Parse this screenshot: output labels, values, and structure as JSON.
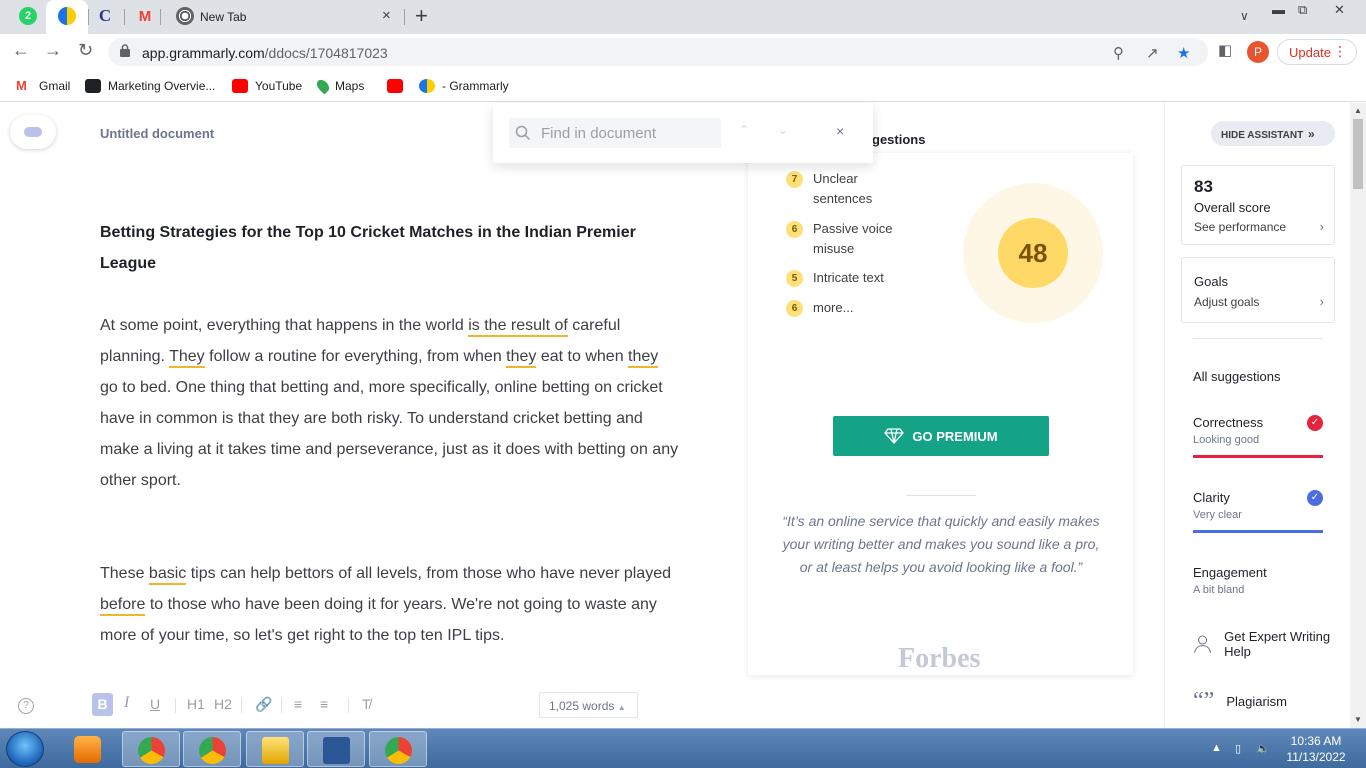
{
  "browser": {
    "tabs": [
      {
        "icon": "whatsapp-icon",
        "badge": "2"
      },
      {
        "icon": "grammarly-icon"
      },
      {
        "icon": "c-letter-icon",
        "glyph": "C"
      },
      {
        "icon": "gmail-icon",
        "glyph": "M"
      },
      {
        "icon": "chrome-icon",
        "title": "New Tab"
      }
    ],
    "close_tab": "×",
    "new_tab": "+",
    "url_host": "app.grammarly.com",
    "url_path": "/ddocs/1704817023",
    "profile_initial": "P",
    "update_label": "Update",
    "bookmarks": [
      {
        "label": "Gmail",
        "color": "#ea4335"
      },
      {
        "label": "Marketing Overvie...",
        "color": "#202124"
      },
      {
        "label": "YouTube",
        "color": "#ff0000"
      },
      {
        "label": "Maps",
        "color": "#34a853"
      },
      {
        "label": "",
        "color": "#ff0000"
      },
      {
        "label": "- Grammarly",
        "color": "#15c39a"
      }
    ]
  },
  "editor": {
    "doc_title": "Untitled document",
    "heading": "Betting Strategies for the Top 10 Cricket Matches in the Indian Premier League",
    "para1": {
      "a": "At some point, everything that happens in the world ",
      "u1": "is the result of",
      "b": " careful planning. ",
      "u2": "They",
      "c": " follow a routine for everything, from when ",
      "u3": "they",
      "d": " eat to when ",
      "u4": "they",
      "e": " go to bed. One thing that betting and, more specifically, online betting on cricket have in common is that they are both risky. To understand cricket betting and make a living at it takes time and perseverance, just as it does with betting on any other sport."
    },
    "para2": {
      "a": "These ",
      "u1": "basic",
      "b": " tips can help bettors of all levels, from those who have never played ",
      "u2": "before",
      "c": " to those who have been doing it for years. We're not going to waste any more of your time, so let's get right to the top ten IPL tips."
    },
    "find_placeholder": "Find in document",
    "find_close": "×",
    "format": {
      "bold": "B",
      "italic": "I",
      "underline": "U",
      "h1": "H1",
      "h2": "H2"
    },
    "word_count": "1,025 words"
  },
  "suggestions": {
    "header_fragment": "gestions",
    "metrics": [
      {
        "count": "7",
        "label": "Unclear sentences"
      },
      {
        "count": "6",
        "label": "Passive voice misuse"
      },
      {
        "count": "5",
        "label": "Intricate text"
      },
      {
        "count": "6",
        "label": "more..."
      }
    ],
    "score": "48",
    "premium_label": "GO PREMIUM",
    "quote_lines": [
      "“It’s an online service that quickly and easily makes",
      "your writing better and makes you sound like a pro,",
      "or at least helps you avoid looking like a fool.”"
    ],
    "quote_source": "Forbes"
  },
  "assistant": {
    "hide_label": "HIDE ASSISTANT",
    "overall_score": "83",
    "overall_label": "Overall score",
    "overall_link": "See performance",
    "goals_label": "Goals",
    "goals_link": "Adjust goals",
    "all_suggestions": "All suggestions",
    "categories": [
      {
        "name": "Correctness",
        "state": "Looking good",
        "color": "#e5233d"
      },
      {
        "name": "Clarity",
        "state": "Very clear",
        "color": "#4a6ee0"
      },
      {
        "name": "Engagement",
        "state": "A bit bland",
        "color": ""
      }
    ],
    "expert_label": "Get Expert Writing Help",
    "plagiarism_label": "Plagiarism"
  },
  "taskbar": {
    "time": "10:36 AM",
    "date": "11/13/2022"
  }
}
